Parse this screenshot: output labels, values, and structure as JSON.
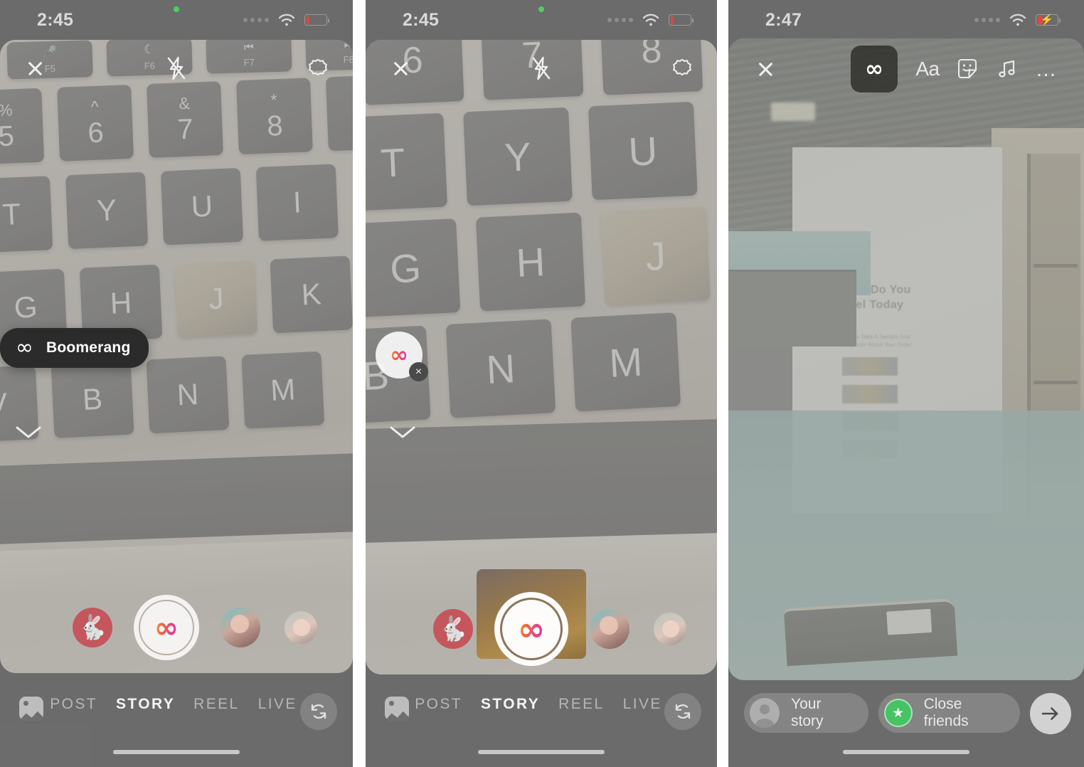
{
  "panels": [
    {
      "id": "panel-1",
      "statusbar": {
        "time": "2:45",
        "signal": "signal-dots",
        "wifi": "wifi-icon",
        "battery": "battery-low-icon",
        "charging": false
      },
      "camera_top": {
        "close": "close-icon",
        "flash": "flash-off-icon",
        "settings": "settings-gear-icon"
      },
      "tooltip": {
        "icon": "infinity-icon",
        "label": "Boomerang"
      },
      "chevron": "chevron-down-icon",
      "effects": [
        {
          "name": "rabbit-effect",
          "glyph": "🐇"
        },
        {
          "name": "portrait-effect-1"
        },
        {
          "name": "portrait-effect-2"
        }
      ],
      "shutter": {
        "icon": "infinity-icon",
        "state": "boomerang-selected",
        "active": false
      },
      "modes": [
        {
          "label": "POST",
          "active": false
        },
        {
          "label": "STORY",
          "active": true
        },
        {
          "label": "REEL",
          "active": false
        },
        {
          "label": "LIVE",
          "active": false
        }
      ],
      "gallery": "gallery-icon",
      "flip": "camera-flip-icon"
    },
    {
      "id": "panel-2",
      "statusbar": {
        "time": "2:45",
        "signal": "signal-dots",
        "wifi": "wifi-icon",
        "battery": "battery-low-icon",
        "charging": false
      },
      "camera_top": {
        "close": "close-icon",
        "flash": "flash-off-icon",
        "settings": "settings-gear-icon"
      },
      "badge": {
        "icon": "infinity-icon",
        "close": "close-icon"
      },
      "chevron": "chevron-down-icon",
      "effects": [
        {
          "name": "rabbit-effect",
          "glyph": "🐇"
        },
        {
          "name": "portrait-effect-1"
        },
        {
          "name": "portrait-effect-2"
        }
      ],
      "shutter": {
        "icon": "infinity-icon",
        "state": "boomerang-selected",
        "active": true
      },
      "modes": [
        {
          "label": "POST",
          "active": false
        },
        {
          "label": "STORY",
          "active": true
        },
        {
          "label": "REEL",
          "active": false
        },
        {
          "label": "LIVE",
          "active": false
        }
      ],
      "gallery": "gallery-icon",
      "flip": "camera-flip-icon"
    },
    {
      "id": "panel-3",
      "statusbar": {
        "time": "2:47",
        "signal": "signal-dots",
        "wifi": "wifi-icon",
        "battery": "battery-charging-icon",
        "charging": true
      },
      "editor_top": {
        "close": "close-icon",
        "tools": [
          {
            "name": "boomerang-tool",
            "icon": "infinity-icon",
            "label": "∞",
            "active": true
          },
          {
            "name": "text-tool",
            "icon": "text-aa-icon",
            "label": "Aa",
            "active": false
          },
          {
            "name": "sticker-tool",
            "icon": "sticker-smiley-icon",
            "active": false
          },
          {
            "name": "music-tool",
            "icon": "music-note-icon",
            "active": false
          },
          {
            "name": "more-tool",
            "icon": "more-dots-icon",
            "label": "…",
            "active": false
          }
        ]
      },
      "scene": {
        "poster_title": "How Do You\nFeel Today ?",
        "poster_subtitle": "Please Take A Sample\nAnd Regiester About Your Order"
      },
      "share": {
        "your_story": {
          "label": "Your story",
          "avatar": "avatar-icon"
        },
        "close_friends": {
          "label": "Close friends",
          "badge": "green-star-icon",
          "badge_color": "#47c264"
        },
        "next": {
          "name": "next-arrow-button",
          "icon": "arrow-right-icon"
        }
      }
    }
  ],
  "colors": {
    "gradient_start": "#f0a83b",
    "gradient_mid": "#ef6a3c",
    "gradient_end": "#cf359c",
    "close_friends_green": "#47c264",
    "battery_red": "#e8443a",
    "recording_dot_green": "#4ad15e"
  },
  "glyphs": {
    "infinity": "∞",
    "close_x": "×",
    "star": "★",
    "ellipsis": "…"
  }
}
